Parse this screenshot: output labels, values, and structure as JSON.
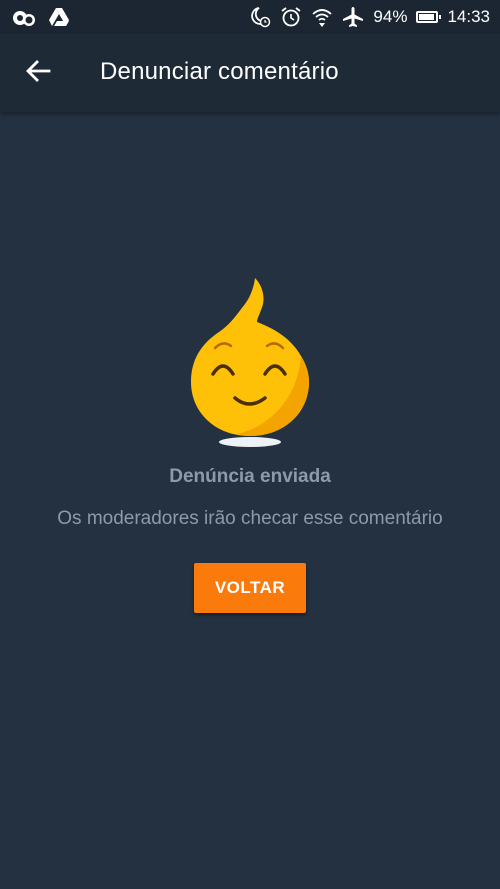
{
  "status_bar": {
    "left_icons": [
      "chat-bubbles-icon",
      "drive-icon"
    ],
    "right_icons": [
      "moon-alarm-icon",
      "alarm-clock-icon",
      "wifi-icon",
      "airplane-icon"
    ],
    "battery_percent": "94%",
    "battery_level": 0.94,
    "time": "14:33"
  },
  "app_bar": {
    "back_icon": "arrow-left-icon",
    "title": "Denunciar comentário"
  },
  "main": {
    "mascot": "fire-smiley-mascot",
    "title": "Denúncia enviada",
    "subtitle": "Os moderadores irão checar esse comentário",
    "back_button_label": "VOLTAR"
  },
  "colors": {
    "background": "#243141",
    "app_bar": "#1f2a37",
    "accent": "#fa7b0c",
    "muted_text": "#8d9aab",
    "mascot_yellow": "#ffc107"
  }
}
